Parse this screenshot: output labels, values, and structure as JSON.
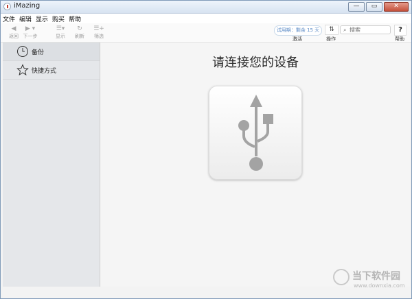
{
  "window": {
    "title": "iMazing",
    "controls": [
      "—",
      "▭",
      "✕"
    ]
  },
  "menu": [
    "文件",
    "编辑",
    "显示",
    "购买",
    "帮助"
  ],
  "toolbar": {
    "back": "返回",
    "forward": "下一步",
    "view": "显示",
    "refresh": "刷新",
    "filter": "筛选",
    "trial": "试用期：剩余 15 天",
    "activate": "激活",
    "actions": "操作",
    "search_placeholder": "搜索",
    "help": "帮助",
    "help_glyph": "?"
  },
  "sidebar": {
    "items": [
      {
        "label": "备份",
        "icon": "clock-icon"
      },
      {
        "label": "快捷方式",
        "icon": "star-icon"
      }
    ]
  },
  "main": {
    "message": "请连接您的设备",
    "icon": "usb-icon"
  },
  "watermark": {
    "text": "当下软件园",
    "url": "www.downxia.com"
  }
}
